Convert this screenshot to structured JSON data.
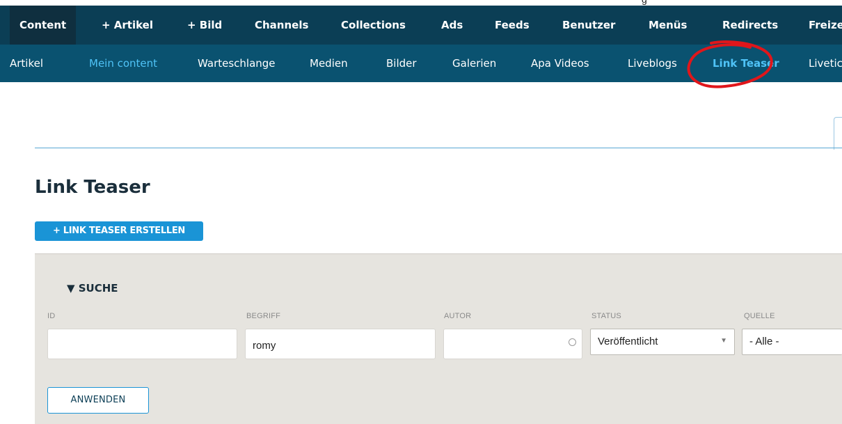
{
  "top_partial_text": "g",
  "nav_primary": [
    "Content",
    "+ Artikel",
    "+ Bild",
    "Channels",
    "Collections",
    "Ads",
    "Feeds",
    "Benutzer",
    "Menüs",
    "Redirects",
    "Freize"
  ],
  "nav_secondary": [
    "Artikel",
    "Mein content",
    "Warteschlange",
    "Medien",
    "Bilder",
    "Galerien",
    "Apa Videos",
    "Liveblogs",
    "Link Teaser",
    "Livetic"
  ],
  "page": {
    "title": "Link Teaser",
    "create_button": "+ LINK TEASER ERSTELLEN"
  },
  "filter": {
    "toggle_label": "▼ SUCHE",
    "fields": {
      "id": {
        "label": "ID",
        "value": ""
      },
      "begriff": {
        "label": "BEGRIFF",
        "value": "romy"
      },
      "autor": {
        "label": "AUTOR",
        "value": ""
      },
      "status": {
        "label": "STATUS",
        "value": "Veröffentlicht"
      },
      "quelle": {
        "label": "QUELLE",
        "value": "- Alle -"
      }
    },
    "apply_button": "ANWENDEN"
  },
  "colors": {
    "nav_primary_bg": "#0b3e55",
    "nav_secondary_bg": "#0a5270",
    "accent": "#1a94d6",
    "annotation": "#e0161b"
  },
  "icons": {
    "status_dropdown": "chevron-down-icon",
    "autor_autocomplete": "circle-icon"
  }
}
